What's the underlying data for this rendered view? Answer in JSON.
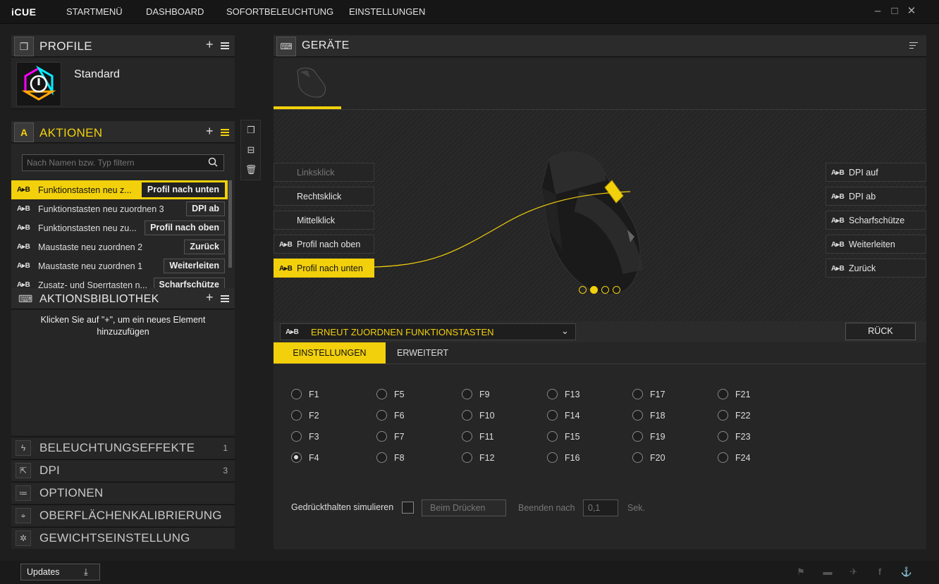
{
  "app": {
    "logo": "iCUE"
  },
  "nav": [
    "STARTMENÜ",
    "DASHBOARD",
    "SOFORTBELEUCHTUNG",
    "EINSTELLUNGEN"
  ],
  "window": {
    "minimize": "–",
    "maximize": "□",
    "close": "✕"
  },
  "profile": {
    "header": "PROFILE",
    "name": "Standard"
  },
  "actions": {
    "header": "AKTIONEN",
    "search_placeholder": "Nach Namen bzw. Typ filtern",
    "ab_icon": "A▸B",
    "items": [
      {
        "label": "Funktionstasten neu z...",
        "tag": "Profil nach unten"
      },
      {
        "label": "Funktionstasten neu zuordnen 3",
        "tag": "DPI ab"
      },
      {
        "label": "Funktionstasten neu zu...",
        "tag": "Profil nach oben"
      },
      {
        "label": "Maustaste neu zuordnen 2",
        "tag": "Zurück"
      },
      {
        "label": "Maustaste neu zuordnen 1",
        "tag": "Weiterleiten"
      },
      {
        "label": "Zusatz- und Sperrtasten n...",
        "tag": "Scharfschütze"
      }
    ]
  },
  "library": {
    "header": "AKTIONSBIBLIOTHEK",
    "empty_text": "Klicken Sie auf \"+\", um ein neues Element hinzuzufügen"
  },
  "bottom_sections": [
    {
      "label": "BELEUCHTUNGSEFFEKTE",
      "count": "1",
      "icon": "lightning-icon"
    },
    {
      "label": "DPI",
      "count": "3",
      "icon": "dpi-icon"
    },
    {
      "label": "OPTIONEN",
      "count": "",
      "icon": "options-icon"
    },
    {
      "label": "OBERFLÄCHENKALIBRIERUNG",
      "count": "",
      "icon": "calibration-icon"
    },
    {
      "label": "GEWICHTSEINSTELLUNG",
      "count": "",
      "icon": "weight-icon"
    }
  ],
  "devices": {
    "header": "GERÄTE"
  },
  "mouse_buttons_left": [
    {
      "label": "Linksklick",
      "ab": false
    },
    {
      "label": "Rechtsklick",
      "ab": false
    },
    {
      "label": "Mittelklick",
      "ab": false
    },
    {
      "label": "Profil nach oben",
      "ab": true
    },
    {
      "label": "Profil nach unten",
      "ab": true
    }
  ],
  "mouse_buttons_right": [
    "DPI auf",
    "DPI ab",
    "Scharfschütze",
    "Weiterleiten",
    "Zurück"
  ],
  "remap": {
    "dropdown_label": "ERNEUT ZUORDNEN FUNKTIONSTASTEN",
    "back_button": "RÜCK",
    "tabs": [
      "EINSTELLUNGEN",
      "ERWEITERT"
    ],
    "keys": [
      [
        "F1",
        "F2",
        "F3",
        "F4"
      ],
      [
        "F5",
        "F6",
        "F7",
        "F8"
      ],
      [
        "F9",
        "F10",
        "F11",
        "F12"
      ],
      [
        "F13",
        "F14",
        "F15",
        "F16"
      ],
      [
        "F17",
        "F18",
        "F19",
        "F20"
      ],
      [
        "F21",
        "F22",
        "F23",
        "F24"
      ]
    ],
    "selected": "F4",
    "hold_label": "Gedrückthalten simulieren",
    "on_press": "Beim Drücken",
    "end_after": "Beenden nach",
    "end_value": "0,1",
    "unit": "Sek."
  },
  "footer": {
    "updates": "Updates"
  },
  "colors": {
    "accent": "#f2d00b",
    "panel": "#2b2b2b",
    "bg": "#1e1e1e"
  }
}
